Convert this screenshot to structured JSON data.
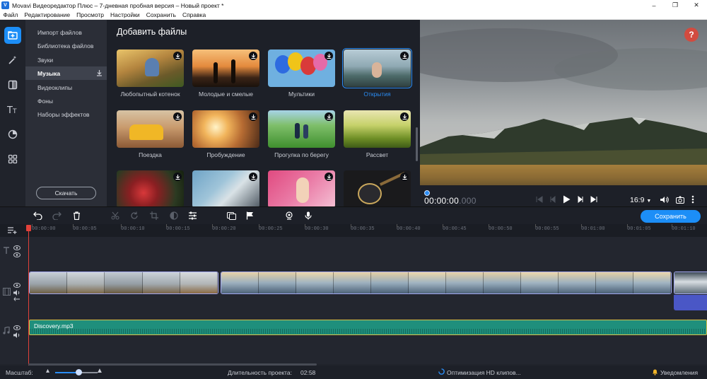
{
  "window": {
    "title": "Movavi Видеоредактор Плюс – 7-дневная пробная версия – Новый проект *",
    "app_icon": "movavi-logo-icon",
    "controls": [
      "minimize-icon",
      "maximize-icon",
      "close-icon"
    ]
  },
  "menu": [
    "Файл",
    "Редактирование",
    "Просмотр",
    "Настройки",
    "Сохранить",
    "Справка"
  ],
  "rail": [
    "import-files-icon",
    "magic-wand-icon",
    "transitions-icon",
    "titles-icon",
    "filters-icon",
    "more-tools-icon"
  ],
  "categories": {
    "items": [
      {
        "label": "Импорт файлов",
        "active": false
      },
      {
        "label": "Библиотека файлов",
        "active": false
      },
      {
        "label": "Звуки",
        "active": false
      },
      {
        "label": "Музыка",
        "active": true
      },
      {
        "label": "Видеоклипы",
        "active": false
      },
      {
        "label": "Фоны",
        "active": false
      },
      {
        "label": "Наборы эффектов",
        "active": false
      }
    ],
    "download_label": "Скачать"
  },
  "media": {
    "title": "Добавить файлы",
    "tiles": [
      {
        "label": "Любопытный котенок",
        "selected": false
      },
      {
        "label": "Молодые и смелые",
        "selected": false
      },
      {
        "label": "Мультики",
        "selected": false
      },
      {
        "label": "Открытия",
        "selected": true
      },
      {
        "label": "Поездка",
        "selected": false
      },
      {
        "label": "Пробуждение",
        "selected": false
      },
      {
        "label": "Прогулка по берегу",
        "selected": false
      },
      {
        "label": "Рассвет",
        "selected": false
      },
      {
        "label": "",
        "selected": false
      },
      {
        "label": "",
        "selected": false
      },
      {
        "label": "",
        "selected": false
      },
      {
        "label": "",
        "selected": false
      }
    ]
  },
  "preview": {
    "help": "?",
    "timecode_main": "00:00:00",
    "timecode_ms": ".000",
    "aspect": "16:9"
  },
  "toolbar": {
    "save_label": "Сохранить"
  },
  "ruler": [
    "00:00:00",
    "00:00:05",
    "00:00:10",
    "00:00:15",
    "00:00:20",
    "00:00:25",
    "00:00:30",
    "00:00:35",
    "00:00:40",
    "00:00:45",
    "00:00:50",
    "00:00:55",
    "00:01:00",
    "00:01:05",
    "00:01:10"
  ],
  "timeline": {
    "audio_clip": "Discovery.mp3"
  },
  "status": {
    "scale_label": "Масштаб:",
    "scale_value": 0.55,
    "duration_label": "Длительность проекта:",
    "duration": "02:58",
    "optimizing": "Оптимизация HD клипов...",
    "notifications": "Уведомления"
  },
  "colors": {
    "accent": "#1c8ef7",
    "danger": "#d24b3f",
    "audio": "#1f8f7c"
  }
}
